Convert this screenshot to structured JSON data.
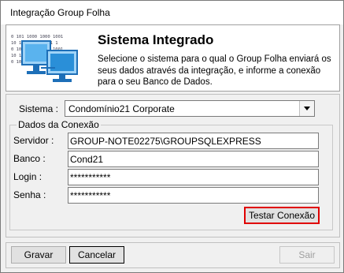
{
  "window": {
    "title": "Integração Group Folha"
  },
  "header": {
    "title": "Sistema Integrado",
    "description": "Selecione o sistema para o qual o Group Folha enviará os seus dados através da integração, e informe a conexão para o seu Banco de Dados.",
    "binary_lines": [
      "0 101 1000 1000 1001",
      "10 100 1000 1001 1",
      "0 101 1000 1000 1001",
      "10 100 1000 1001 1",
      "0 101 1000 1000 1001"
    ],
    "icon": "computers-network-icon"
  },
  "sistema": {
    "label": "Sistema :",
    "value": "Condomínio21 Corporate"
  },
  "conexao": {
    "legend": "Dados da Conexão",
    "servidor": {
      "label": "Servidor :",
      "value": "GROUP-NOTE02275\\GROUPSQLEXPRESS"
    },
    "banco": {
      "label": "Banco :",
      "value": "Cond21"
    },
    "login": {
      "label": "Login :",
      "value": "***********"
    },
    "senha": {
      "label": "Senha :",
      "value": "***********"
    },
    "test_button": "Testar Conexão"
  },
  "footer": {
    "save": "Gravar",
    "cancel": "Cancelar",
    "exit": "Sair"
  },
  "colors": {
    "highlight": "#e00000",
    "window_bg": "#f0f0f0",
    "monitor": "#2a8fd8"
  }
}
